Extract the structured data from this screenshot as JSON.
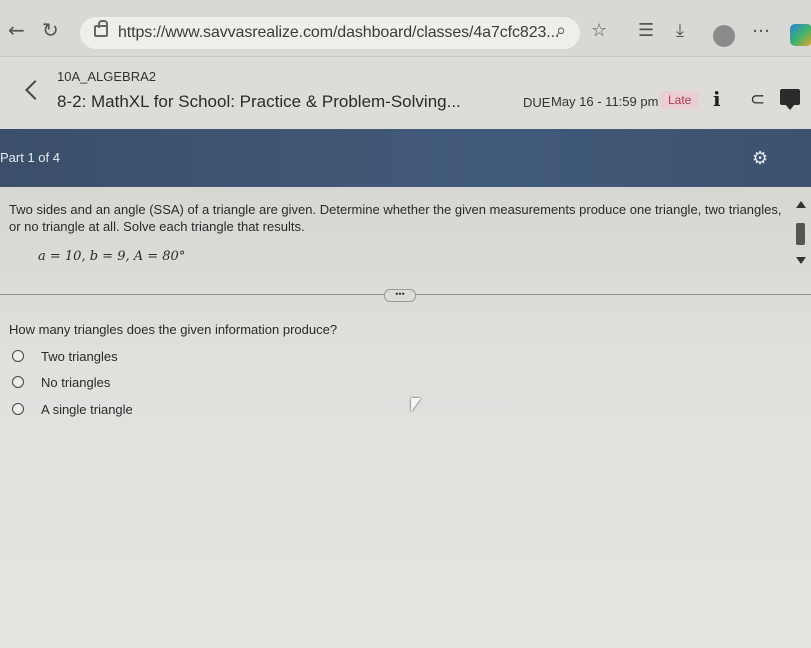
{
  "browser": {
    "url": "https://www.savvasrealize.com/dashboard/classes/4a7cfc823...",
    "icons": [
      "back-arrow-icon",
      "refresh-icon",
      "lock-icon",
      "zoom-icon",
      "favorite-star-icon",
      "favorites-list-icon",
      "download-icon",
      "profile-avatar",
      "more-options-icon",
      "copilot-icon"
    ]
  },
  "header": {
    "class_code": "10A_ALGEBRA2",
    "title": "8-2: MathXL for School: Practice & Problem-Solving...",
    "due_label": "DUE",
    "due_date": "May 16 - 11:59 pm",
    "late_label": "Late",
    "late_color": "#b13a55"
  },
  "part": {
    "label": "Part 1 of 4",
    "bar_color": "#425a7a"
  },
  "question": {
    "problem": "Two sides and an angle (SSA) of a triangle are given. Determine whether the given measurements produce one triangle, two triangles, or no triangle at all. Solve each triangle that results.",
    "given": "a = 10,  b = 9,    A = 80°",
    "more_handle": "•••",
    "prompt": "How many triangles does the given information produce?",
    "options": [
      "Two triangles",
      "No triangles",
      "A single triangle"
    ]
  }
}
